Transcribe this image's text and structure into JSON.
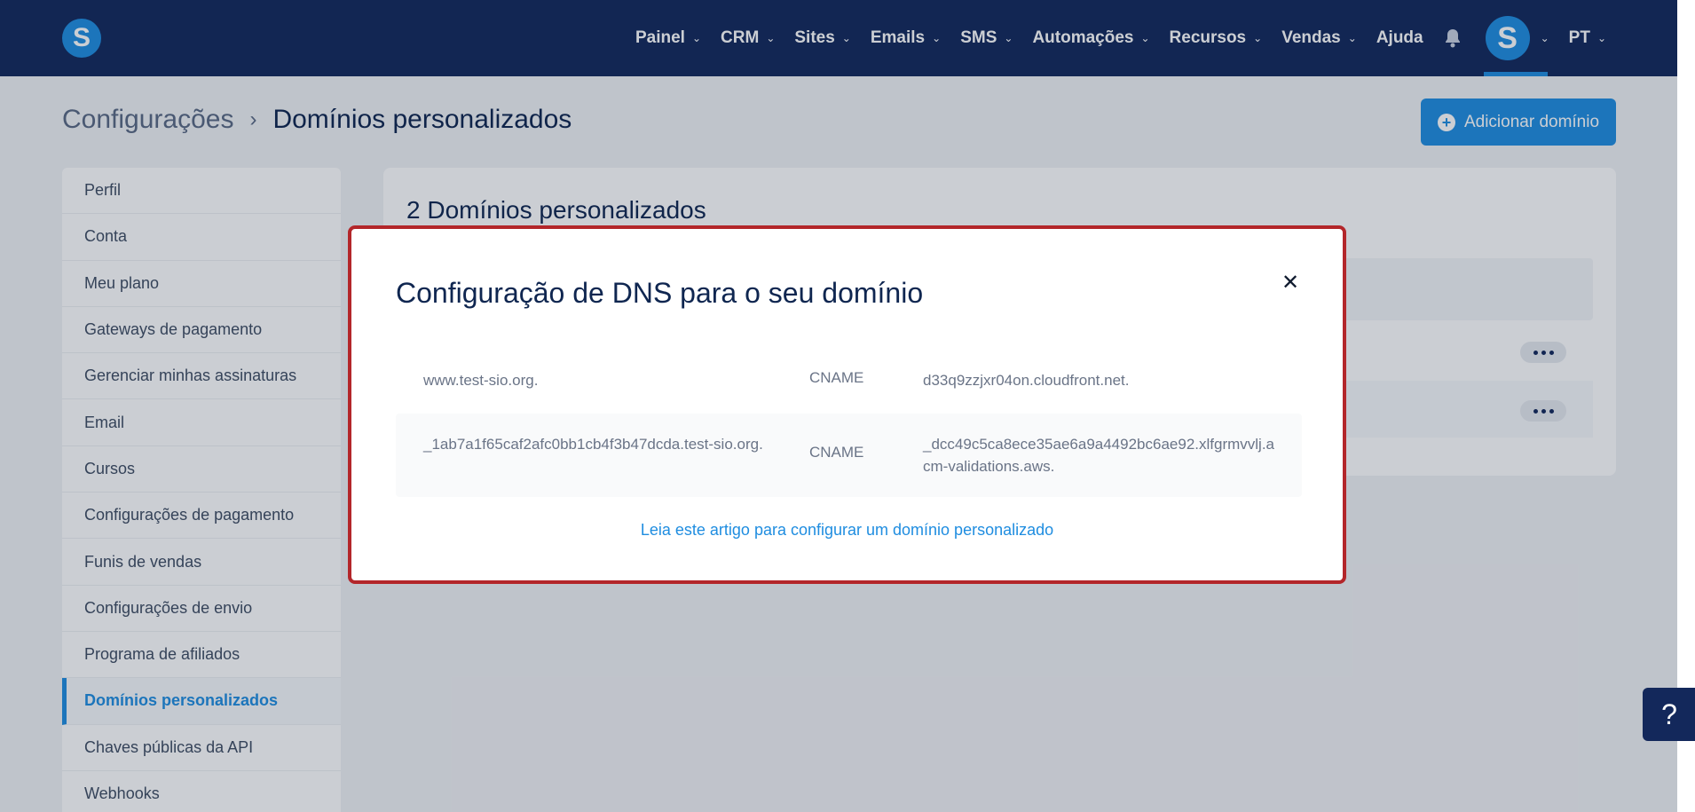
{
  "nav": {
    "items": [
      {
        "label": "Painel",
        "has_dropdown": true
      },
      {
        "label": "CRM",
        "has_dropdown": true
      },
      {
        "label": "Sites",
        "has_dropdown": true
      },
      {
        "label": "Emails",
        "has_dropdown": true
      },
      {
        "label": "SMS",
        "has_dropdown": true
      },
      {
        "label": "Automações",
        "has_dropdown": true
      },
      {
        "label": "Recursos",
        "has_dropdown": true
      },
      {
        "label": "Vendas",
        "has_dropdown": true
      },
      {
        "label": "Ajuda",
        "has_dropdown": false
      }
    ],
    "logo_letter": "S",
    "avatar_letter": "S",
    "language": "PT"
  },
  "breadcrumb": {
    "parent": "Configurações",
    "current": "Domínios personalizados"
  },
  "add_button": {
    "label": "Adicionar domínio"
  },
  "sidebar": {
    "items": [
      {
        "label": "Perfil",
        "active": false
      },
      {
        "label": "Conta",
        "active": false
      },
      {
        "label": "Meu plano",
        "active": false
      },
      {
        "label": "Gateways de pagamento",
        "active": false
      },
      {
        "label": "Gerenciar minhas assinaturas",
        "active": false
      },
      {
        "label": "Email",
        "active": false
      },
      {
        "label": "Cursos",
        "active": false
      },
      {
        "label": "Configurações de pagamento",
        "active": false
      },
      {
        "label": "Funis de vendas",
        "active": false
      },
      {
        "label": "Configurações de envio",
        "active": false
      },
      {
        "label": "Programa de afiliados",
        "active": false
      },
      {
        "label": "Domínios personalizados",
        "active": true
      },
      {
        "label": "Chaves públicas da API",
        "active": false
      },
      {
        "label": "Webhooks",
        "active": false
      }
    ]
  },
  "main": {
    "title": "2 Domínios personalizados"
  },
  "modal": {
    "title": "Configuração de DNS para o seu domínio",
    "records": [
      {
        "host": "www.test-sio.org.",
        "type": "CNAME",
        "value": "d33q9zzjxr04on.cloudfront.net."
      },
      {
        "host": "_1ab7a1f65caf2afc0bb1cb4f3b47dcda.test-sio.org.",
        "type": "CNAME",
        "value": "_dcc49c5ca8ece35ae6a9a4492bc6ae92.xlfgrmvvlj.acm-validations.aws."
      }
    ],
    "help_link": "Leia este artigo para configurar um domínio personalizado"
  },
  "help_fab": {
    "label": "?"
  },
  "colors": {
    "navy": "#13285b",
    "accent": "#1f8de0",
    "modal_border": "#b3262a"
  }
}
